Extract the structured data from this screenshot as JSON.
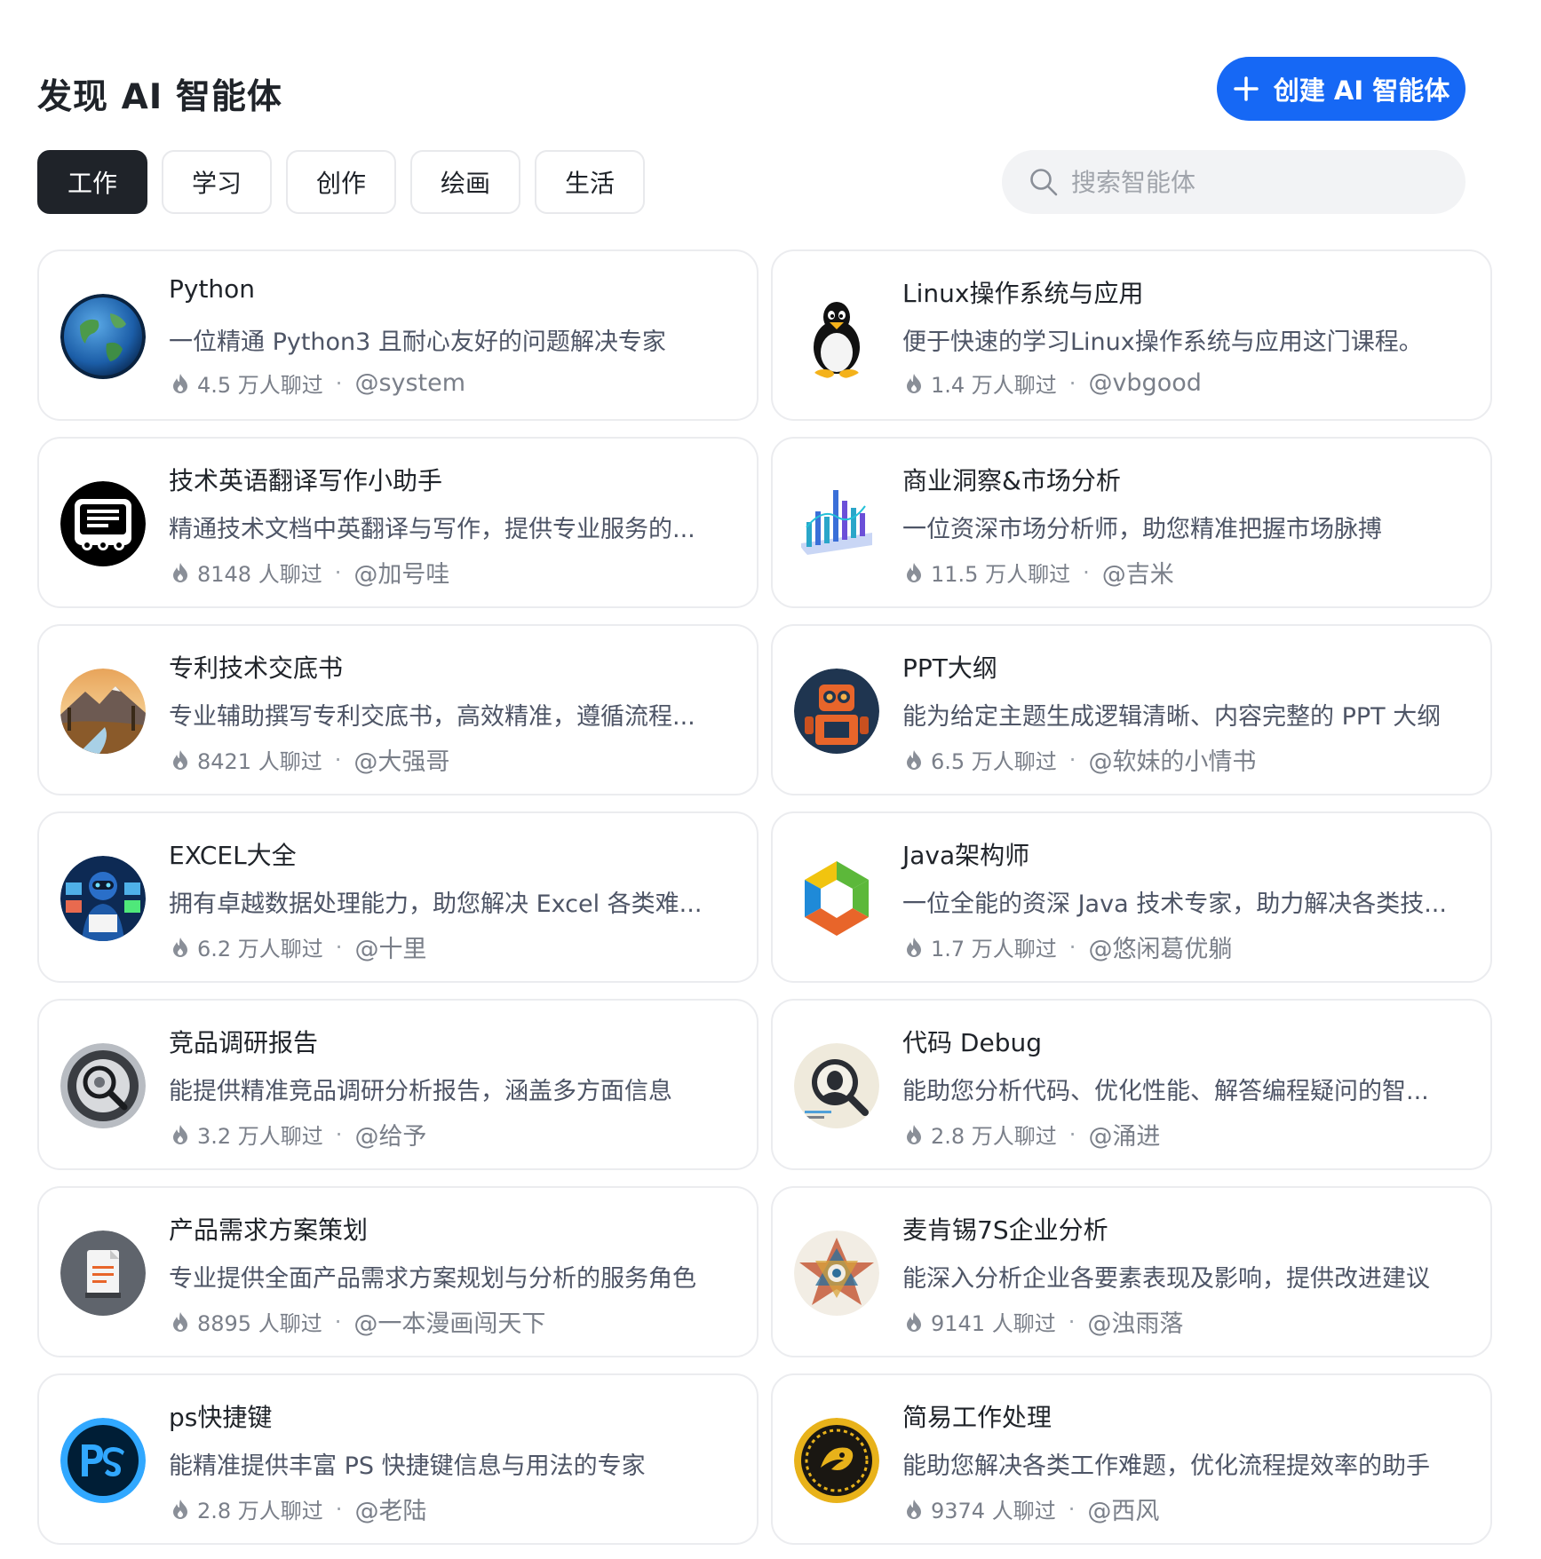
{
  "header": {
    "title": "发现 AI 智能体",
    "create_label": "创建 AI 智能体"
  },
  "tabs": [
    {
      "label": "工作",
      "active": true
    },
    {
      "label": "学习",
      "active": false
    },
    {
      "label": "创作",
      "active": false
    },
    {
      "label": "绘画",
      "active": false
    },
    {
      "label": "生活",
      "active": false
    }
  ],
  "search": {
    "placeholder": "搜索智能体"
  },
  "colors": {
    "accent": "#1668f5",
    "active_tab": "#1f2329"
  },
  "agents": [
    {
      "name": "Python",
      "desc": "一位精通 Python3 且耐心友好的问题解决专家",
      "chats": "4.5 万人聊过",
      "author": "@system",
      "icon": "globe-avatar"
    },
    {
      "name": "Linux操作系统与应用",
      "desc": "便于快速的学习Linux操作系统与应用这门课程。",
      "chats": "1.4 万人聊过",
      "author": "@vbgood",
      "icon": "penguin-avatar"
    },
    {
      "name": "技术英语翻译写作小助手",
      "desc": "精通技术文档中英翻译与写作，提供专业服务的...",
      "chats": "8148 人聊过",
      "author": "@加号哇",
      "icon": "robot-document-avatar"
    },
    {
      "name": "商业洞察&市场分析",
      "desc": "一位资深市场分析师，助您精准把握市场脉搏",
      "chats": "11.5 万人聊过",
      "author": "@吉米",
      "icon": "bar-chart-avatar"
    },
    {
      "name": "专利技术交底书",
      "desc": "专业辅助撰写专利交底书，高效精准，遵循流程...",
      "chats": "8421 人聊过",
      "author": "@大强哥",
      "icon": "landscape-avatar"
    },
    {
      "name": "PPT大纲",
      "desc": "能为给定主题生成逻辑清晰、内容完整的 PPT 大纲",
      "chats": "6.5 万人聊过",
      "author": "@软妹的小情书",
      "icon": "robot-ppt-avatar"
    },
    {
      "name": "EXCEL大全",
      "desc": "拥有卓越数据处理能力，助您解决 Excel 各类难...",
      "chats": "6.2 万人聊过",
      "author": "@十里",
      "icon": "data-robot-avatar"
    },
    {
      "name": "Java架构师",
      "desc": "一位全能的资深 Java 技术专家，助力解决各类技...",
      "chats": "1.7 万人聊过",
      "author": "@悠闲葛优躺",
      "icon": "architect-hexagon-avatar"
    },
    {
      "name": "竞品调研报告",
      "desc": "能提供精准竞品调研分析报告，涵盖多方面信息",
      "chats": "3.2 万人聊过",
      "author": "@给予",
      "icon": "magnifier-gear-avatar"
    },
    {
      "name": "代码 Debug",
      "desc": "能助您分析代码、优化性能、解答编程疑问的智...",
      "chats": "2.8 万人聊过",
      "author": "@涌进",
      "icon": "debug-magnifier-avatar"
    },
    {
      "name": "产品需求方案策划",
      "desc": "专业提供全面产品需求方案规划与分析的服务角色",
      "chats": "8895 人聊过",
      "author": "@一本漫画闯天下",
      "icon": "document-avatar"
    },
    {
      "name": "麦肯锡7S企业分析",
      "desc": "能深入分析企业各要素表现及影响，提供改进建议",
      "chats": "9141 人聊过",
      "author": "@浊雨落",
      "icon": "star-mandala-avatar"
    },
    {
      "name": "ps快捷键",
      "desc": "能精准提供丰富 PS 快捷键信息与用法的专家",
      "chats": "2.8 万人聊过",
      "author": "@老陆",
      "icon": "photoshop-avatar"
    },
    {
      "name": "简易工作处理",
      "desc": "能助您解决各类工作难题，优化流程提效率的助手",
      "chats": "9374 人聊过",
      "author": "@西风",
      "icon": "golden-emblem-avatar"
    }
  ]
}
